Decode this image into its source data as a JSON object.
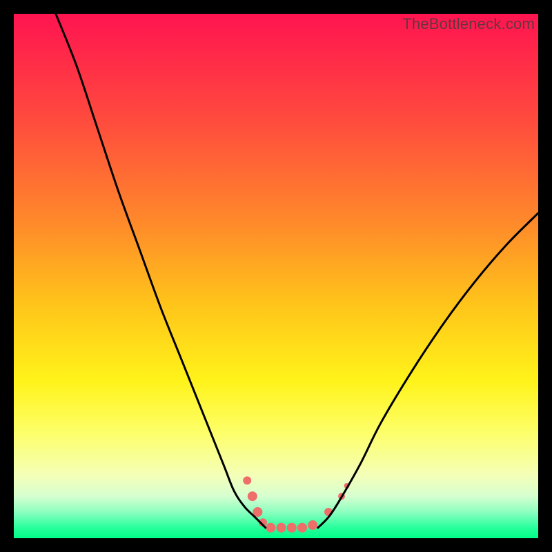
{
  "watermark": "TheBottleneck.com",
  "chart_data": {
    "type": "line",
    "title": "",
    "xlabel": "",
    "ylabel": "",
    "xlim": [
      0,
      100
    ],
    "ylim": [
      0,
      100
    ],
    "gradient_stops": [
      {
        "offset": 0,
        "color": "#ff1450"
      },
      {
        "offset": 20,
        "color": "#ff4a3e"
      },
      {
        "offset": 40,
        "color": "#ff8a2a"
      },
      {
        "offset": 55,
        "color": "#ffc31a"
      },
      {
        "offset": 70,
        "color": "#fff31a"
      },
      {
        "offset": 80,
        "color": "#fdff6a"
      },
      {
        "offset": 88,
        "color": "#f4ffb8"
      },
      {
        "offset": 92,
        "color": "#d6ffd0"
      },
      {
        "offset": 95,
        "color": "#8cffc0"
      },
      {
        "offset": 98,
        "color": "#28ff9c"
      },
      {
        "offset": 100,
        "color": "#00ff88"
      }
    ],
    "series": [
      {
        "name": "left-curve",
        "color": "#000000",
        "x": [
          8,
          12,
          16,
          20,
          24,
          28,
          32,
          36,
          40,
          42,
          44,
          46,
          48
        ],
        "y": [
          100,
          90,
          78,
          66,
          55,
          44,
          34,
          24,
          14,
          9,
          6,
          4,
          2
        ]
      },
      {
        "name": "right-curve",
        "color": "#000000",
        "x": [
          58,
          60,
          62,
          66,
          70,
          76,
          82,
          88,
          94,
          100
        ],
        "y": [
          2,
          4,
          7,
          14,
          22,
          32,
          41,
          49,
          56,
          62
        ]
      }
    ],
    "markers": {
      "name": "bottom-clusters",
      "color": "#ee6e6a",
      "points": [
        {
          "x": 44.5,
          "y": 11,
          "r": 6
        },
        {
          "x": 45.5,
          "y": 8,
          "r": 7
        },
        {
          "x": 46.5,
          "y": 5,
          "r": 7
        },
        {
          "x": 47.5,
          "y": 3,
          "r": 6
        },
        {
          "x": 49,
          "y": 2,
          "r": 7
        },
        {
          "x": 51,
          "y": 2,
          "r": 7
        },
        {
          "x": 53,
          "y": 2,
          "r": 7
        },
        {
          "x": 55,
          "y": 2,
          "r": 7
        },
        {
          "x": 57,
          "y": 2.5,
          "r": 7
        },
        {
          "x": 60,
          "y": 5,
          "r": 6
        },
        {
          "x": 62.5,
          "y": 8,
          "r": 5
        },
        {
          "x": 63.5,
          "y": 10,
          "r": 4
        }
      ]
    }
  }
}
